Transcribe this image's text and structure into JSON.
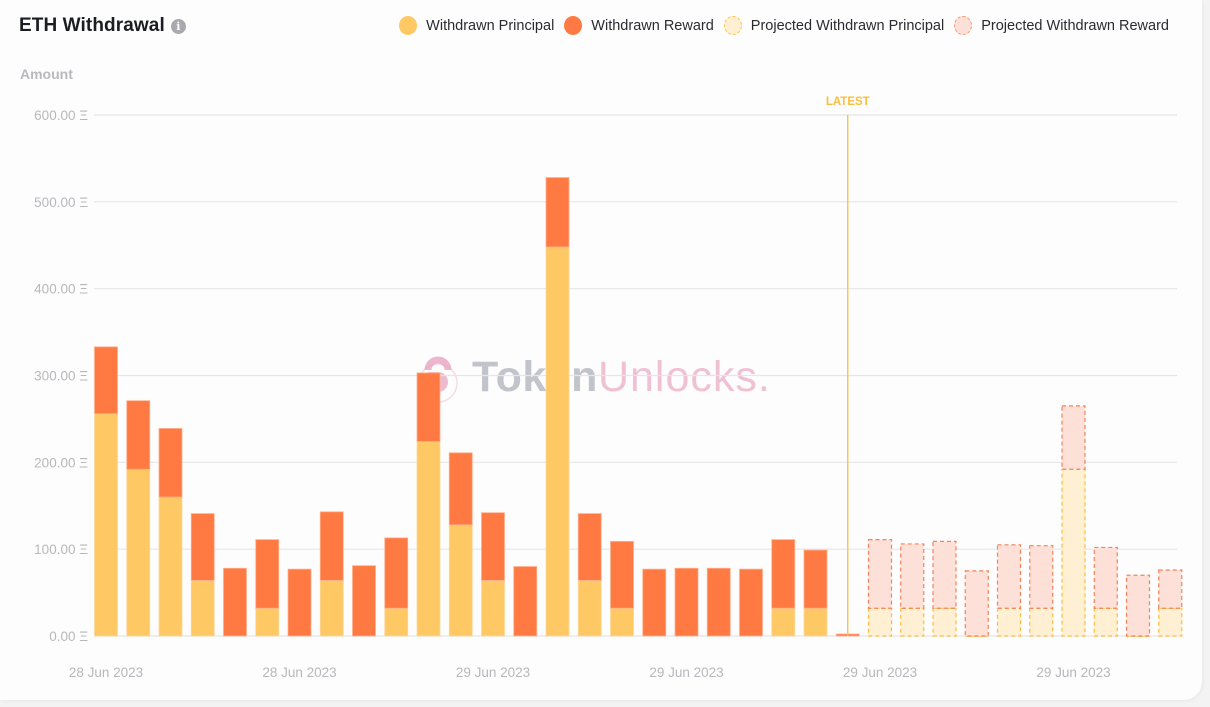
{
  "header": {
    "title": "ETH Withdrawal",
    "info_icon": "info-icon"
  },
  "legend": [
    {
      "label": "Withdrawn Principal",
      "color": "#fec964",
      "border": "#fec964",
      "dashed": false
    },
    {
      "label": "Withdrawn Reward",
      "color": "#ff7a42",
      "border": "#ff7a42",
      "dashed": false
    },
    {
      "label": "Projected Withdrawn Principal",
      "color": "#fff0d3",
      "border": "#fdc34f",
      "dashed": true
    },
    {
      "label": "Projected Withdrawn Reward",
      "color": "#fde1d8",
      "border": "#f6976d",
      "dashed": true
    }
  ],
  "watermark": {
    "part1": "Token",
    "part2": "Unlocks."
  },
  "colors": {
    "principal": "#fec964",
    "reward": "#ff7a42",
    "projected_principal_fill": "#fff0d3",
    "projected_principal_stroke": "#fdbd3a",
    "projected_reward_fill": "#fde1d8",
    "projected_reward_stroke": "#f5825a",
    "latest_line": "#fbbd3a",
    "grid": "#e6e6e8"
  },
  "chart_data": {
    "type": "bar",
    "stacked": true,
    "title": "ETH Withdrawal",
    "ylabel": "Amount",
    "xlabel": "",
    "ylim": [
      0,
      600
    ],
    "yticks": [
      "0.00 Ξ",
      "100.00 Ξ",
      "200.00 Ξ",
      "300.00 Ξ",
      "400.00 Ξ",
      "500.00 Ξ",
      "600.00 Ξ"
    ],
    "ytick_values": [
      0,
      100,
      200,
      300,
      400,
      500,
      600
    ],
    "xtick_labels": [
      "28 Jun 2023",
      "28 Jun 2023",
      "29 Jun 2023",
      "29 Jun 2023",
      "29 Jun 2023",
      "29 Jun 2023"
    ],
    "xtick_every": 6,
    "grid": true,
    "legend_position": "top-right",
    "latest_marker": {
      "label": "LATEST",
      "index": 23
    },
    "series": [
      {
        "name": "Withdrawn Principal",
        "values": [
          256,
          192,
          160,
          64,
          0,
          32,
          0,
          64,
          0,
          32,
          224,
          128,
          64,
          0,
          448,
          64,
          32,
          0,
          0,
          0,
          0,
          32,
          32,
          0,
          null,
          null,
          null,
          null,
          null,
          null,
          null,
          null,
          null,
          null
        ]
      },
      {
        "name": "Withdrawn Reward",
        "values": [
          77,
          79,
          79,
          77,
          78,
          79,
          77,
          79,
          81,
          81,
          79,
          83,
          78,
          80,
          80,
          77,
          77,
          77,
          78,
          78,
          77,
          79,
          67,
          1,
          null,
          null,
          null,
          null,
          null,
          null,
          null,
          null,
          null,
          null
        ]
      },
      {
        "name": "Projected Withdrawn Principal",
        "values": [
          null,
          null,
          null,
          null,
          null,
          null,
          null,
          null,
          null,
          null,
          null,
          null,
          null,
          null,
          null,
          null,
          null,
          null,
          null,
          null,
          null,
          null,
          null,
          null,
          32,
          32,
          32,
          0,
          32,
          32,
          192,
          32,
          0,
          32
        ]
      },
      {
        "name": "Projected Withdrawn Reward",
        "values": [
          null,
          null,
          null,
          null,
          null,
          null,
          null,
          null,
          null,
          null,
          null,
          null,
          null,
          null,
          null,
          null,
          null,
          null,
          null,
          null,
          null,
          null,
          null,
          null,
          79,
          74,
          77,
          75,
          73,
          72,
          73,
          70,
          70,
          44
        ]
      }
    ]
  }
}
